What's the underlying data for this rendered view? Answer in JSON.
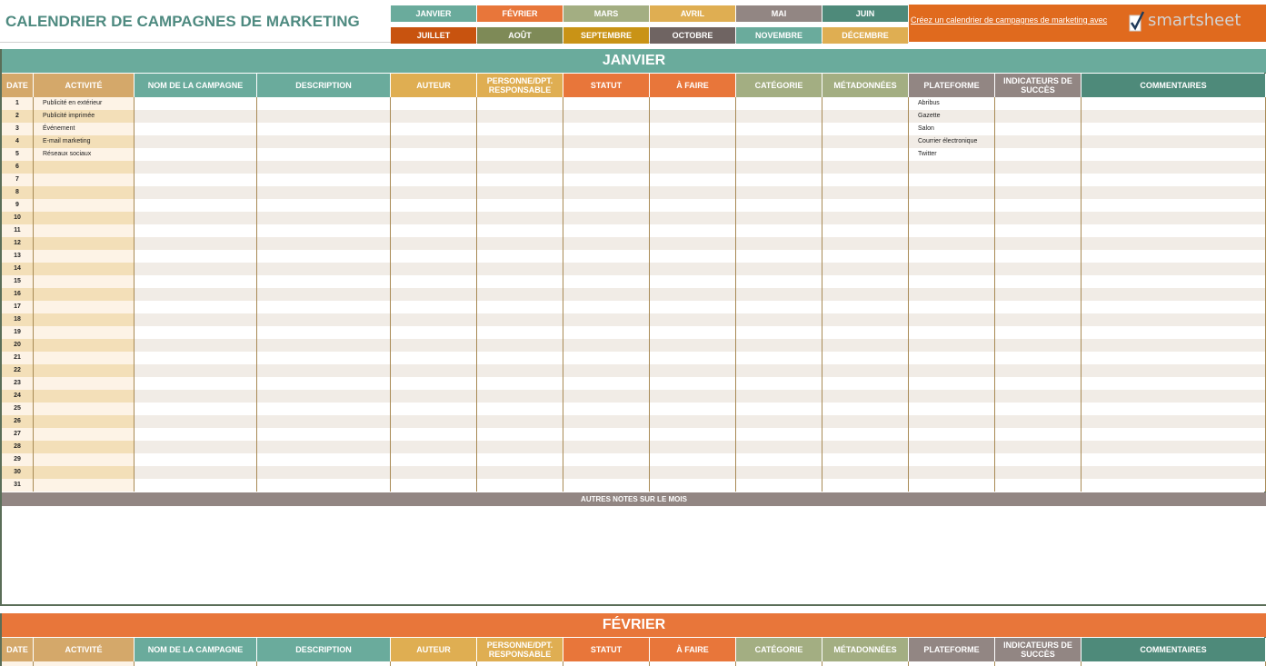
{
  "title": "CALENDRIER DE CAMPAGNES DE MARKETING",
  "months_nav": [
    {
      "label": "JANVIER",
      "color": "#6aab9c"
    },
    {
      "label": "FÉVRIER",
      "color": "#e8763a"
    },
    {
      "label": "MARS",
      "color": "#a3ae82"
    },
    {
      "label": "AVRIL",
      "color": "#dfae52"
    },
    {
      "label": "MAI",
      "color": "#928683"
    },
    {
      "label": "JUIN",
      "color": "#4e8a7a"
    },
    {
      "label": "JUILLET",
      "color": "#c8530f"
    },
    {
      "label": "AOÛT",
      "color": "#7e8a57"
    },
    {
      "label": "SEPTEMBRE",
      "color": "#c99316"
    },
    {
      "label": "OCTOBRE",
      "color": "#6f6462"
    },
    {
      "label": "NOVEMBRE",
      "color": "#6aab9c"
    },
    {
      "label": "DÉCEMBRE",
      "color": "#dfae52"
    }
  ],
  "promo": {
    "text": "Créez un calendrier de campagnes de marketing avec",
    "brand": "smartsheet"
  },
  "columns": [
    {
      "label": "DATE",
      "color": "#d4a86a"
    },
    {
      "label": "ACTIVITÉ",
      "color": "#d4a86a"
    },
    {
      "label": "NOM DE LA CAMPAGNE",
      "color": "#6aab9c"
    },
    {
      "label": "DESCRIPTION",
      "color": "#6aab9c"
    },
    {
      "label": "AUTEUR",
      "color": "#dfae52"
    },
    {
      "label": "PERSONNE/DPT. RESPONSABLE",
      "color": "#dfae52"
    },
    {
      "label": "STATUT",
      "color": "#e8763a"
    },
    {
      "label": "À FAIRE",
      "color": "#e8763a"
    },
    {
      "label": "CATÉGORIE",
      "color": "#a3ae82"
    },
    {
      "label": "MÉTADONNÉES",
      "color": "#a3ae82"
    },
    {
      "label": "PLATEFORME",
      "color": "#928683"
    },
    {
      "label": "INDICATEURS DE SUCCÈS",
      "color": "#928683"
    },
    {
      "label": "COMMENTAIRES",
      "color": "#4e8a7a"
    }
  ],
  "sections": [
    {
      "month": "JANVIER",
      "color": "#6aab9c",
      "activities": [
        "Publicité en extérieur",
        "Publicité imprimée",
        "Événement",
        "E-mail marketing",
        "Réseaux sociaux"
      ],
      "platforms": [
        "Abribus",
        "Gazette",
        "Salon",
        "Courrier électronique",
        "Twitter"
      ],
      "days": 31,
      "notes_label": "AUTRES NOTES SUR LE MOIS"
    },
    {
      "month": "FÉVRIER",
      "color": "#e8763a"
    }
  ]
}
